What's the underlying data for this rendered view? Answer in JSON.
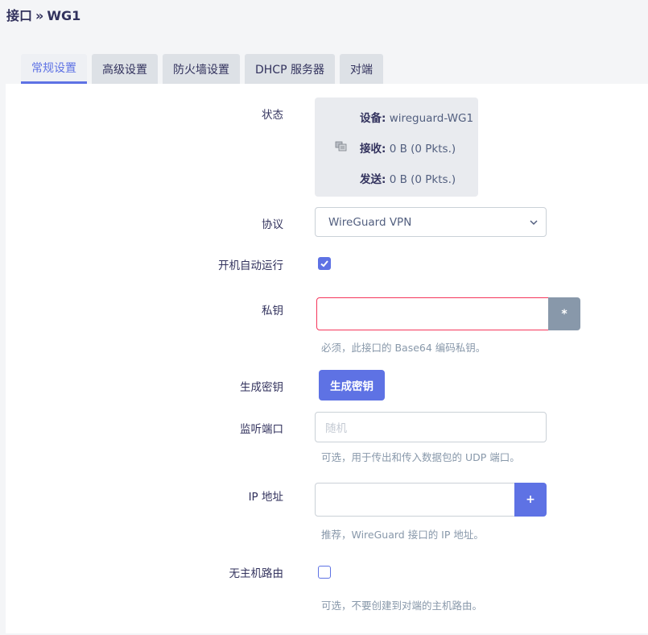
{
  "header": {
    "section": "接口",
    "separator": "»",
    "interface": "WG1"
  },
  "tabs": [
    {
      "label": "常规设置",
      "active": true
    },
    {
      "label": "高级设置",
      "active": false
    },
    {
      "label": "防火墙设置",
      "active": false
    },
    {
      "label": "DHCP 服务器",
      "active": false
    },
    {
      "label": "对端",
      "active": false
    }
  ],
  "form": {
    "status": {
      "label": "状态",
      "device_key": "设备:",
      "device_value": "wireguard-WG1",
      "rx_key": "接收:",
      "rx_value": "0 B (0 Pkts.)",
      "tx_key": "发送:",
      "tx_value": "0 B (0 Pkts.)",
      "icon": "network-device-icon"
    },
    "protocol": {
      "label": "协议",
      "value": "WireGuard VPN"
    },
    "autostart": {
      "label": "开机自动运行",
      "checked": true
    },
    "private_key": {
      "label": "私钥",
      "value": "",
      "reveal_label": "*",
      "hint": "必须，此接口的 Base64 编码私钥。"
    },
    "generate_key": {
      "label": "生成密钥",
      "button_label": "生成密钥"
    },
    "listen_port": {
      "label": "监听端口",
      "placeholder": "随机",
      "hint": "可选，用于传出和传入数据包的 UDP 端口。"
    },
    "ip_address": {
      "label": "IP 地址",
      "value": "",
      "add_label": "+",
      "hint": "推荐，WireGuard 接口的 IP 地址。"
    },
    "no_host_route": {
      "label": "无主机路由",
      "checked": false,
      "hint": "可选，不要创建到对端的主机路由。"
    }
  },
  "colors": {
    "accent": "#5e72e4",
    "error": "#f5365c",
    "muted_button": "#8898aa"
  }
}
